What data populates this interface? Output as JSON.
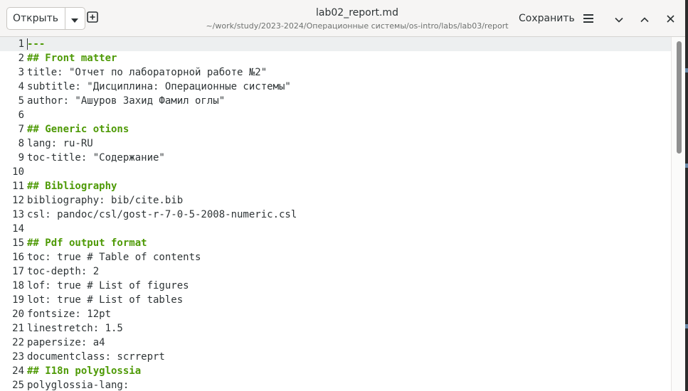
{
  "header": {
    "open_label": "Открыть",
    "filename": "lab02_report.md",
    "filepath": "~/work/study/2023-2024/Операционные системы/os-intro/labs/lab03/report",
    "save_label": "Сохранить"
  },
  "editor": {
    "lines": [
      {
        "n": "1",
        "text": "---",
        "heading": true,
        "current": true
      },
      {
        "n": "2",
        "text": "## Front matter",
        "heading": true
      },
      {
        "n": "3",
        "text": "title: \"Отчет по лабораторной работе №2\""
      },
      {
        "n": "4",
        "text": "subtitle: \"Дисциплина: Операционные системы\""
      },
      {
        "n": "5",
        "text": "author: \"Ашуров Захид Фамил оглы\""
      },
      {
        "n": "6",
        "text": ""
      },
      {
        "n": "7",
        "text": "## Generic otions",
        "heading": true
      },
      {
        "n": "8",
        "text": "lang: ru-RU"
      },
      {
        "n": "9",
        "text": "toc-title: \"Содержание\""
      },
      {
        "n": "10",
        "text": ""
      },
      {
        "n": "11",
        "text": "## Bibliography",
        "heading": true
      },
      {
        "n": "12",
        "text": "bibliography: bib/cite.bib"
      },
      {
        "n": "13",
        "text": "csl: pandoc/csl/gost-r-7-0-5-2008-numeric.csl"
      },
      {
        "n": "14",
        "text": ""
      },
      {
        "n": "15",
        "text": "## Pdf output format",
        "heading": true
      },
      {
        "n": "16",
        "text": "toc: true # Table of contents"
      },
      {
        "n": "17",
        "text": "toc-depth: 2"
      },
      {
        "n": "18",
        "text": "lof: true # List of figures"
      },
      {
        "n": "19",
        "text": "lot: true # List of tables"
      },
      {
        "n": "20",
        "text": "fontsize: 12pt"
      },
      {
        "n": "21",
        "text": "linestretch: 1.5"
      },
      {
        "n": "22",
        "text": "papersize: a4"
      },
      {
        "n": "23",
        "text": "documentclass: scrreprt"
      },
      {
        "n": "24",
        "text": "## I18n polyglossia",
        "heading": true
      },
      {
        "n": "25",
        "text": "polyglossia-lang:"
      }
    ]
  },
  "icons": {
    "open_menu": "chevron-down-icon",
    "new_tab": "new-tab-icon",
    "main_menu": "hamburger-menu-icon",
    "minimize": "minimize-icon",
    "maximize": "maximize-icon",
    "close": "close-icon"
  },
  "colors": {
    "heading": "#4e9a06",
    "text": "#2e3436",
    "current_line": "#edeff0",
    "headerbar": "#f6f5f4"
  }
}
